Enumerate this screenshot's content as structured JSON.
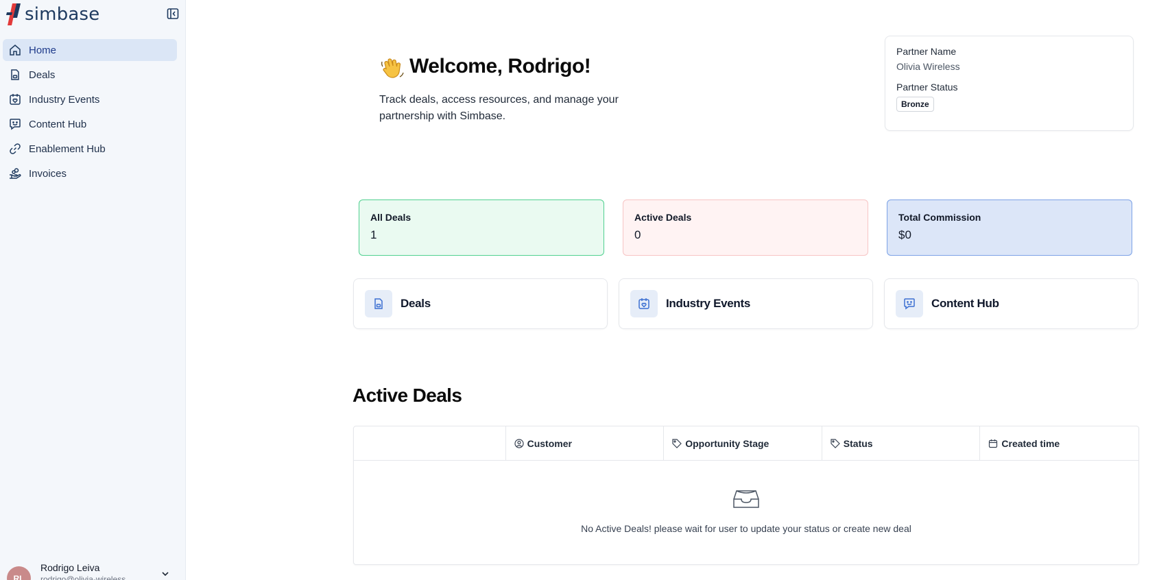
{
  "brand": {
    "name": "simbase",
    "accent": "#1e3a5f",
    "logo_red": "#e23a3a"
  },
  "sidebar": {
    "items": [
      {
        "label": "Home",
        "icon": "home-icon",
        "active": true
      },
      {
        "label": "Deals",
        "icon": "document-icon",
        "active": false
      },
      {
        "label": "Industry Events",
        "icon": "calendar-heart-icon",
        "active": false
      },
      {
        "label": "Content Hub",
        "icon": "chat-smile-icon",
        "active": false
      },
      {
        "label": "Enablement Hub",
        "icon": "link-icon",
        "active": false
      },
      {
        "label": "Invoices",
        "icon": "hand-coins-icon",
        "active": false
      }
    ],
    "user": {
      "initials": "RL",
      "name": "Rodrigo Leiva",
      "sub": "rodrigo@olivia-wireless"
    }
  },
  "welcome": {
    "title": "Welcome, Rodrigo!",
    "subtitle": "Track deals, access resources, and manage your partnership with Simbase."
  },
  "partner": {
    "name_label": "Partner Name",
    "name_value": "Olivia Wireless",
    "status_label": "Partner Status",
    "status_value": "Bronze"
  },
  "stats": [
    {
      "label": "All Deals",
      "value": "1"
    },
    {
      "label": "Active Deals",
      "value": "0"
    },
    {
      "label": "Total Commission",
      "value": "$0"
    }
  ],
  "quick_links": [
    {
      "label": "Deals",
      "icon": "document-icon"
    },
    {
      "label": "Industry Events",
      "icon": "calendar-heart-icon"
    },
    {
      "label": "Content Hub",
      "icon": "chat-smile-icon"
    }
  ],
  "active_deals": {
    "title": "Active Deals",
    "columns": [
      {
        "label": "Customer",
        "icon": "user-circle-icon"
      },
      {
        "label": "Opportunity Stage",
        "icon": "tag-icon"
      },
      {
        "label": "Status",
        "icon": "tag-icon"
      },
      {
        "label": "Created time",
        "icon": "calendar-icon"
      }
    ],
    "empty_text": "No Active Deals! please wait for user to update your status or create new deal"
  }
}
